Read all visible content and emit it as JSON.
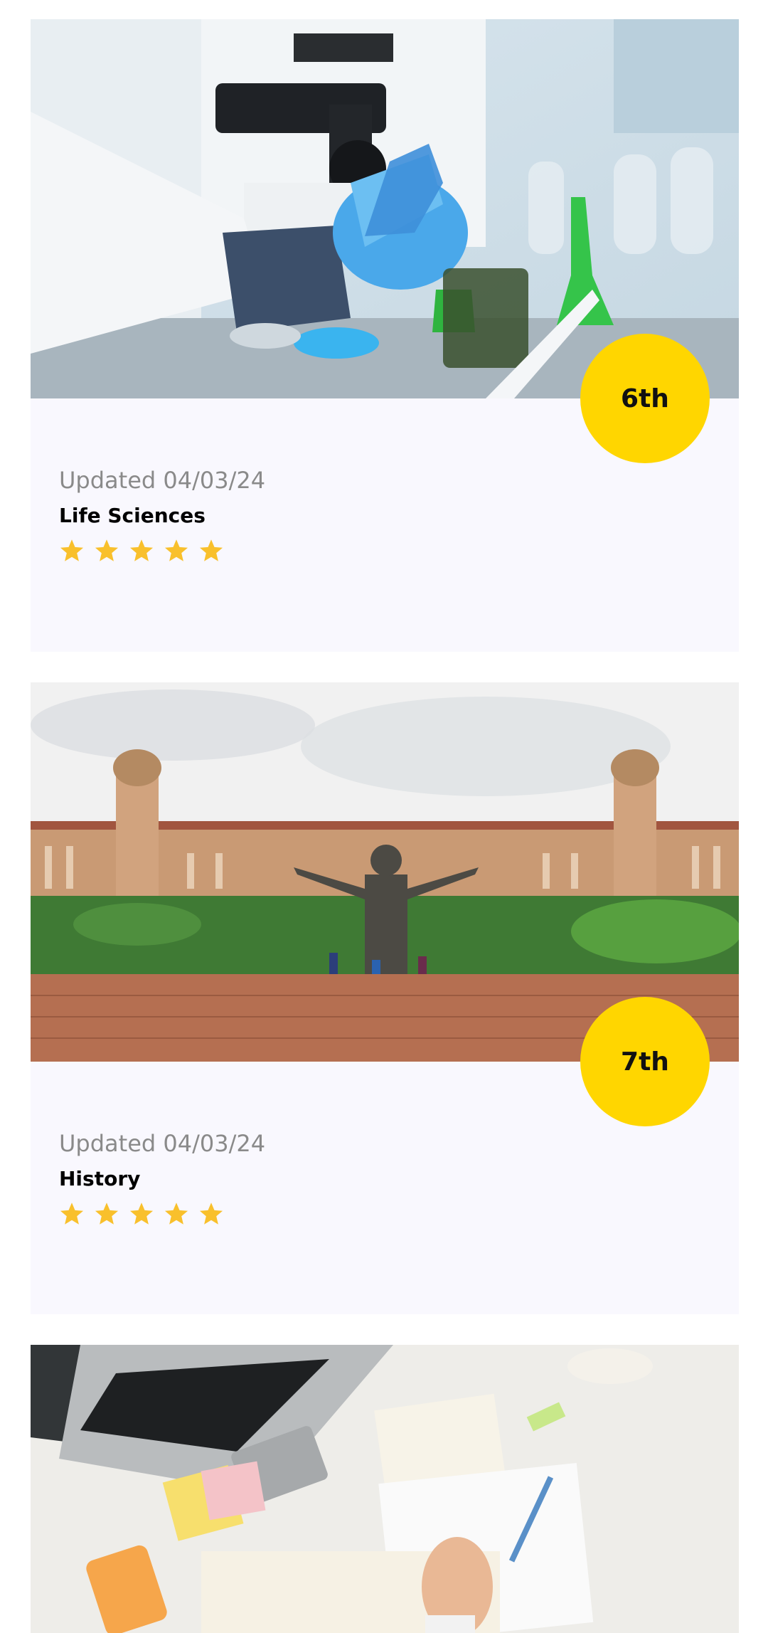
{
  "cards": [
    {
      "grade": "6th",
      "updated": "Updated 04/03/24",
      "subject": "Life Sciences",
      "rating": 5,
      "image": "laboratory-scene"
    },
    {
      "grade": "7th",
      "updated": "Updated 04/03/24",
      "subject": "History",
      "rating": 5,
      "image": "union-buildings-statue-scene"
    },
    {
      "image": "study-desk-scene"
    }
  ],
  "colors": {
    "badge": "#ffd600",
    "star": "#f9c02c",
    "card_bg": "#f9f8fe"
  }
}
